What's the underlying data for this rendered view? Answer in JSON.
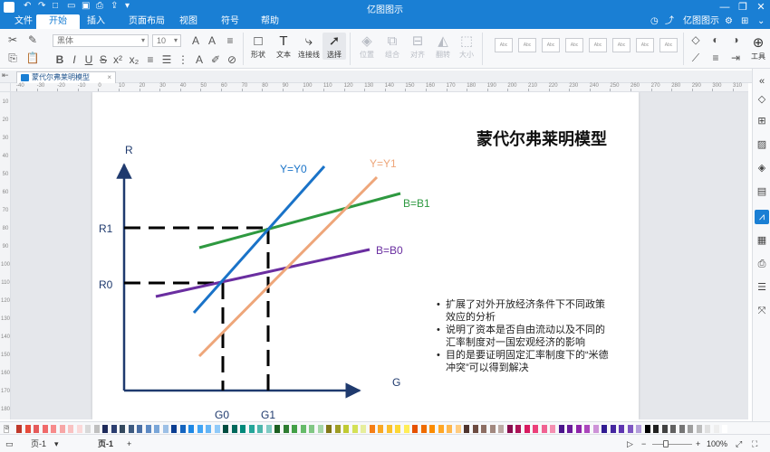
{
  "app": {
    "title": "亿图图示",
    "account": "亿图图示",
    "window_controls": [
      "—",
      "❐",
      "✕"
    ]
  },
  "menu": {
    "items": [
      "文件",
      "开始",
      "插入",
      "页面布局",
      "视图",
      "符号",
      "帮助"
    ],
    "active_index": 1
  },
  "ribbon": {
    "font_name": "黑体",
    "font_size": "10",
    "tools": {
      "shape": "形状",
      "text": "文本",
      "connector": "连接线",
      "select": "选择",
      "position": "位置",
      "group": "组合",
      "align": "对齐",
      "flip": "翻转",
      "size": "大小"
    },
    "style_sample": "Abc",
    "tools_label": "工具"
  },
  "document": {
    "tab_title": "蒙代尔弗莱明模型"
  },
  "rulers": {
    "h_ticks": [
      "-40",
      "-30",
      "-20",
      "-10",
      "0",
      "10",
      "20",
      "30",
      "40",
      "50",
      "60",
      "70",
      "80",
      "90",
      "100",
      "110",
      "120",
      "130",
      "140",
      "150",
      "160",
      "170",
      "180",
      "190",
      "200",
      "210",
      "220",
      "230",
      "240",
      "250",
      "260",
      "270",
      "280",
      "290",
      "300",
      "310",
      "320"
    ],
    "v_ticks": [
      "10",
      "20",
      "30",
      "40",
      "50",
      "60",
      "70",
      "80",
      "90",
      "100",
      "110",
      "120",
      "130",
      "140",
      "150",
      "160",
      "170",
      "180"
    ]
  },
  "diagram": {
    "title": "蒙代尔弗莱明模型",
    "y_axis_label": "R",
    "x_axis_label": "G",
    "r_levels": [
      "R1",
      "R0"
    ],
    "g_levels": [
      "G0",
      "G1"
    ],
    "curves": [
      {
        "label": "Y=Y0",
        "color": "#1a73c8"
      },
      {
        "label": "Y=Y1",
        "color": "#eea67a"
      },
      {
        "label": "B=B1",
        "color": "#2e9940"
      },
      {
        "label": "B=B0",
        "color": "#6a2ea0"
      }
    ],
    "dash_color": "#000000",
    "notes": [
      "扩展了对外开放经济条件下不同政策效应的分析",
      "说明了资本是否自由流动以及不同的汇率制度对一国宏观经济的影响",
      "目的是要证明固定汇率制度下的“米德冲突”可以得到解决"
    ]
  },
  "statusbar": {
    "page_selector": "页-1",
    "page_tab": "页-1",
    "add_page": "+",
    "zoom": "100%"
  },
  "palette_colors": [
    "#c0392b",
    "#e74c3c",
    "#e55b5b",
    "#f06a6a",
    "#f78b8b",
    "#f7a6a6",
    "#f9c2c2",
    "#fbd9d9",
    "#d9d9d9",
    "#bfbfbf",
    "#1e2a5a",
    "#2c3e70",
    "#34495e",
    "#3d5a80",
    "#4a6fa5",
    "#5d8ac4",
    "#7aa6d8",
    "#9dc0e6",
    "#0b3d91",
    "#1565c0",
    "#1e88e5",
    "#42a5f5",
    "#64b5f6",
    "#90caf9",
    "#004d40",
    "#00695c",
    "#00897b",
    "#26a69a",
    "#4db6ac",
    "#80cbc4",
    "#1b5e20",
    "#2e7d32",
    "#43a047",
    "#66bb6a",
    "#81c784",
    "#a5d6a7",
    "#827717",
    "#9e9d24",
    "#c0ca33",
    "#d4e157",
    "#e6ee9c",
    "#f57f17",
    "#f9a825",
    "#fbc02d",
    "#fdd835",
    "#ffee58",
    "#e65100",
    "#ef6c00",
    "#fb8c00",
    "#ffa726",
    "#ffb74d",
    "#ffcc80",
    "#4e342e",
    "#6d4c41",
    "#8d6e63",
    "#a1887f",
    "#bcaaa4",
    "#880e4f",
    "#ad1457",
    "#d81b60",
    "#ec407a",
    "#f06292",
    "#f48fb1",
    "#4a148c",
    "#6a1b9a",
    "#8e24aa",
    "#ab47bc",
    "#ce93d8",
    "#311b92",
    "#4527a0",
    "#5e35b1",
    "#7e57c2",
    "#b39ddb",
    "#000000",
    "#212121",
    "#424242",
    "#616161",
    "#757575",
    "#9e9e9e",
    "#bdbdbd",
    "#e0e0e0",
    "#eeeeee",
    "#ffffff"
  ]
}
